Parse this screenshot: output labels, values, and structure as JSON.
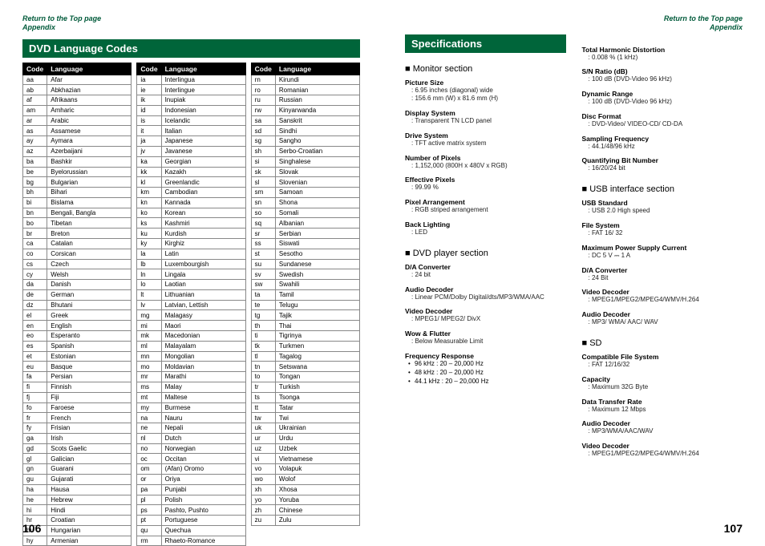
{
  "top_link_1": "Return to the Top page",
  "top_link_2": "Appendix",
  "page_left_number": "106",
  "page_right_number": "107",
  "lang_title": "DVD Language Codes",
  "spec_title": "Specifications",
  "lang_headers": {
    "code": "Code",
    "language": "Language"
  },
  "lang_cols": [
    [
      [
        "aa",
        "Afar"
      ],
      [
        "ab",
        "Abkhazian"
      ],
      [
        "af",
        "Afrikaans"
      ],
      [
        "am",
        "Amharic"
      ],
      [
        "ar",
        "Arabic"
      ],
      [
        "as",
        "Assamese"
      ],
      [
        "ay",
        "Aymara"
      ],
      [
        "az",
        "Azerbaijani"
      ],
      [
        "ba",
        "Bashkir"
      ],
      [
        "be",
        "Byelorussian"
      ],
      [
        "bg",
        "Bulgarian"
      ],
      [
        "bh",
        "Bihari"
      ],
      [
        "bi",
        "Bislama"
      ],
      [
        "bn",
        "Bengali, Bangla"
      ],
      [
        "bo",
        "Tibetan"
      ],
      [
        "br",
        "Breton"
      ],
      [
        "ca",
        "Catalan"
      ],
      [
        "co",
        "Corsican"
      ],
      [
        "cs",
        "Czech"
      ],
      [
        "cy",
        "Welsh"
      ],
      [
        "da",
        "Danish"
      ],
      [
        "de",
        "German"
      ],
      [
        "dz",
        "Bhutani"
      ],
      [
        "el",
        "Greek"
      ],
      [
        "en",
        "English"
      ],
      [
        "eo",
        "Esperanto"
      ],
      [
        "es",
        "Spanish"
      ],
      [
        "et",
        "Estonian"
      ],
      [
        "eu",
        "Basque"
      ],
      [
        "fa",
        "Persian"
      ],
      [
        "fi",
        "Finnish"
      ],
      [
        "fj",
        "Fiji"
      ],
      [
        "fo",
        "Faroese"
      ],
      [
        "fr",
        "French"
      ],
      [
        "fy",
        "Frisian"
      ],
      [
        "ga",
        "Irish"
      ],
      [
        "gd",
        "Scots Gaelic"
      ],
      [
        "gl",
        "Galician"
      ],
      [
        "gn",
        "Guarani"
      ],
      [
        "gu",
        "Gujarati"
      ],
      [
        "ha",
        "Hausa"
      ],
      [
        "he",
        "Hebrew"
      ],
      [
        "hi",
        "Hindi"
      ],
      [
        "hr",
        "Croatian"
      ],
      [
        "hu",
        "Hungarian"
      ],
      [
        "hy",
        "Armenian"
      ]
    ],
    [
      [
        "ia",
        "Interlingua"
      ],
      [
        "ie",
        "Interlingue"
      ],
      [
        "ik",
        "Inupiak"
      ],
      [
        "id",
        "Indonesian"
      ],
      [
        "is",
        "Icelandic"
      ],
      [
        "it",
        "Italian"
      ],
      [
        "ja",
        "Japanese"
      ],
      [
        "jv",
        "Javanese"
      ],
      [
        "ka",
        "Georgian"
      ],
      [
        "kk",
        "Kazakh"
      ],
      [
        "kl",
        "Greenlandic"
      ],
      [
        "km",
        "Cambodian"
      ],
      [
        "kn",
        "Kannada"
      ],
      [
        "ko",
        "Korean"
      ],
      [
        "ks",
        "Kashmiri"
      ],
      [
        "ku",
        "Kurdish"
      ],
      [
        "ky",
        "Kirghiz"
      ],
      [
        "la",
        "Latin"
      ],
      [
        "lb",
        "Luxembourgish"
      ],
      [
        "ln",
        "Lingala"
      ],
      [
        "lo",
        "Laotian"
      ],
      [
        "lt",
        "Lithuanian"
      ],
      [
        "lv",
        "Latvian, Lettish"
      ],
      [
        "mg",
        "Malagasy"
      ],
      [
        "mi",
        "Maori"
      ],
      [
        "mk",
        "Macedonian"
      ],
      [
        "ml",
        "Malayalam"
      ],
      [
        "mn",
        "Mongolian"
      ],
      [
        "mo",
        "Moldavian"
      ],
      [
        "mr",
        "Marathi"
      ],
      [
        "ms",
        "Malay"
      ],
      [
        "mt",
        "Maltese"
      ],
      [
        "my",
        "Burmese"
      ],
      [
        "na",
        "Nauru"
      ],
      [
        "ne",
        "Nepali"
      ],
      [
        "nl",
        "Dutch"
      ],
      [
        "no",
        "Norwegian"
      ],
      [
        "oc",
        "Occitan"
      ],
      [
        "om",
        "(Afan) Oromo"
      ],
      [
        "or",
        "Oriya"
      ],
      [
        "pa",
        "Punjabi"
      ],
      [
        "pl",
        "Polish"
      ],
      [
        "ps",
        "Pashto, Pushto"
      ],
      [
        "pt",
        "Portuguese"
      ],
      [
        "qu",
        "Quechua"
      ],
      [
        "rm",
        "Rhaeto-Romance"
      ]
    ],
    [
      [
        "rn",
        "Kirundi"
      ],
      [
        "ro",
        "Romanian"
      ],
      [
        "ru",
        "Russian"
      ],
      [
        "rw",
        "Kinyarwanda"
      ],
      [
        "sa",
        "Sanskrit"
      ],
      [
        "sd",
        "Sindhi"
      ],
      [
        "sg",
        "Sangho"
      ],
      [
        "sh",
        "Serbo-Croatian"
      ],
      [
        "si",
        "Singhalese"
      ],
      [
        "sk",
        "Slovak"
      ],
      [
        "sl",
        "Slovenian"
      ],
      [
        "sm",
        "Samoan"
      ],
      [
        "sn",
        "Shona"
      ],
      [
        "so",
        "Somali"
      ],
      [
        "sq",
        "Albanian"
      ],
      [
        "sr",
        "Serbian"
      ],
      [
        "ss",
        "Siswati"
      ],
      [
        "st",
        "Sesotho"
      ],
      [
        "su",
        "Sundanese"
      ],
      [
        "sv",
        "Swedish"
      ],
      [
        "sw",
        "Swahili"
      ],
      [
        "ta",
        "Tamil"
      ],
      [
        "te",
        "Telugu"
      ],
      [
        "tg",
        "Tajik"
      ],
      [
        "th",
        "Thai"
      ],
      [
        "ti",
        "Tigrinya"
      ],
      [
        "tk",
        "Turkmen"
      ],
      [
        "tl",
        "Tagalog"
      ],
      [
        "tn",
        "Setswana"
      ],
      [
        "to",
        "Tongan"
      ],
      [
        "tr",
        "Turkish"
      ],
      [
        "ts",
        "Tsonga"
      ],
      [
        "tt",
        "Tatar"
      ],
      [
        "tw",
        "Twi"
      ],
      [
        "uk",
        "Ukrainian"
      ],
      [
        "ur",
        "Urdu"
      ],
      [
        "uz",
        "Uzbek"
      ],
      [
        "vi",
        "Vietnamese"
      ],
      [
        "vo",
        "Volapuk"
      ],
      [
        "wo",
        "Wolof"
      ],
      [
        "xh",
        "Xhosa"
      ],
      [
        "yo",
        "Yoruba"
      ],
      [
        "zh",
        "Chinese"
      ],
      [
        "zu",
        "Zulu"
      ]
    ]
  ],
  "specs_left": [
    {
      "type": "section",
      "text": "Monitor section"
    },
    {
      "type": "item",
      "label": "Picture Size",
      "values": [
        "6.95 inches (diagonal) wide",
        "156.6 mm (W) x 81.6 mm (H)"
      ]
    },
    {
      "type": "item",
      "label": "Display System",
      "values": [
        "Transparent TN LCD panel"
      ]
    },
    {
      "type": "item",
      "label": "Drive System",
      "values": [
        "TFT active matrix system"
      ]
    },
    {
      "type": "item",
      "label": "Number of Pixels",
      "values": [
        "1,152,000 (800H x 480V x RGB)"
      ]
    },
    {
      "type": "item",
      "label": "Effective Pixels",
      "values": [
        "99.99 %"
      ]
    },
    {
      "type": "item",
      "label": "Pixel Arrangement",
      "values": [
        "RGB striped arrangement"
      ]
    },
    {
      "type": "item",
      "label": "Back Lighting",
      "values": [
        "LED"
      ]
    },
    {
      "type": "section",
      "text": "DVD player section"
    },
    {
      "type": "item",
      "label": "D/A Converter",
      "values": [
        "24 bit"
      ]
    },
    {
      "type": "item",
      "label": "Audio Decoder",
      "values": [
        "Linear PCM/Dolby Digital/dts/MP3/WMA/AAC"
      ]
    },
    {
      "type": "item",
      "label": "Video Decoder",
      "values": [
        "MPEG1/ MPEG2/ DivX"
      ]
    },
    {
      "type": "item",
      "label": "Wow & Flutter",
      "values": [
        "Below Measurable Limit"
      ]
    },
    {
      "type": "item",
      "label": "Frequency Response",
      "bullets": [
        "96 kHz : 20 – 20,000 Hz",
        "48 kHz : 20 – 20,000 Hz",
        "44.1 kHz : 20 – 20,000 Hz"
      ]
    }
  ],
  "specs_right": [
    {
      "type": "item",
      "label": "Total Harmonic Distortion",
      "values": [
        "0.008 % (1 kHz)"
      ]
    },
    {
      "type": "item",
      "label": "S/N Ratio (dB)",
      "values": [
        "100 dB (DVD-Video 96 kHz)"
      ]
    },
    {
      "type": "item",
      "label": "Dynamic Range",
      "values": [
        "100 dB (DVD-Video 96 kHz)"
      ]
    },
    {
      "type": "item",
      "label": "Disc Format",
      "values": [
        "DVD-Video/ VIDEO-CD/ CD-DA"
      ]
    },
    {
      "type": "item",
      "label": "Sampling Frequency",
      "values": [
        "44.1/48/96 kHz"
      ]
    },
    {
      "type": "item",
      "label": "Quantifying Bit Number",
      "values": [
        "16/20/24 bit"
      ]
    },
    {
      "type": "section",
      "text": "USB interface section"
    },
    {
      "type": "item",
      "label": "USB Standard",
      "values": [
        "USB 2.0 High speed"
      ]
    },
    {
      "type": "item",
      "label": "File System",
      "values": [
        "FAT 16/ 32"
      ]
    },
    {
      "type": "item",
      "label": "Maximum Power Supply Current",
      "values": [
        "DC 5 V ⎓ 1 A"
      ]
    },
    {
      "type": "item",
      "label": "D/A Converter",
      "values": [
        "24 Bit"
      ]
    },
    {
      "type": "item",
      "label": "Video Decoder",
      "values": [
        "MPEG1/MPEG2/MPEG4/WMV/H.264"
      ]
    },
    {
      "type": "item",
      "label": "Audio Decoder",
      "values": [
        "MP3/ WMA/ AAC/ WAV"
      ]
    },
    {
      "type": "section",
      "text": "SD"
    },
    {
      "type": "item",
      "label": "Compatible File System",
      "values": [
        "FAT 12/16/32"
      ]
    },
    {
      "type": "item",
      "label": "Capacity",
      "values": [
        "Maximum 32G Byte"
      ]
    },
    {
      "type": "item",
      "label": "Data Transfer Rate",
      "values": [
        "Maximum 12 Mbps"
      ]
    },
    {
      "type": "item",
      "label": "Audio Decoder",
      "values": [
        "MP3/WMA/AAC/WAV"
      ]
    },
    {
      "type": "item",
      "label": "Video Decoder",
      "values": [
        "MPEG1/MPEG2/MPEG4/WMV/H.264"
      ]
    }
  ]
}
